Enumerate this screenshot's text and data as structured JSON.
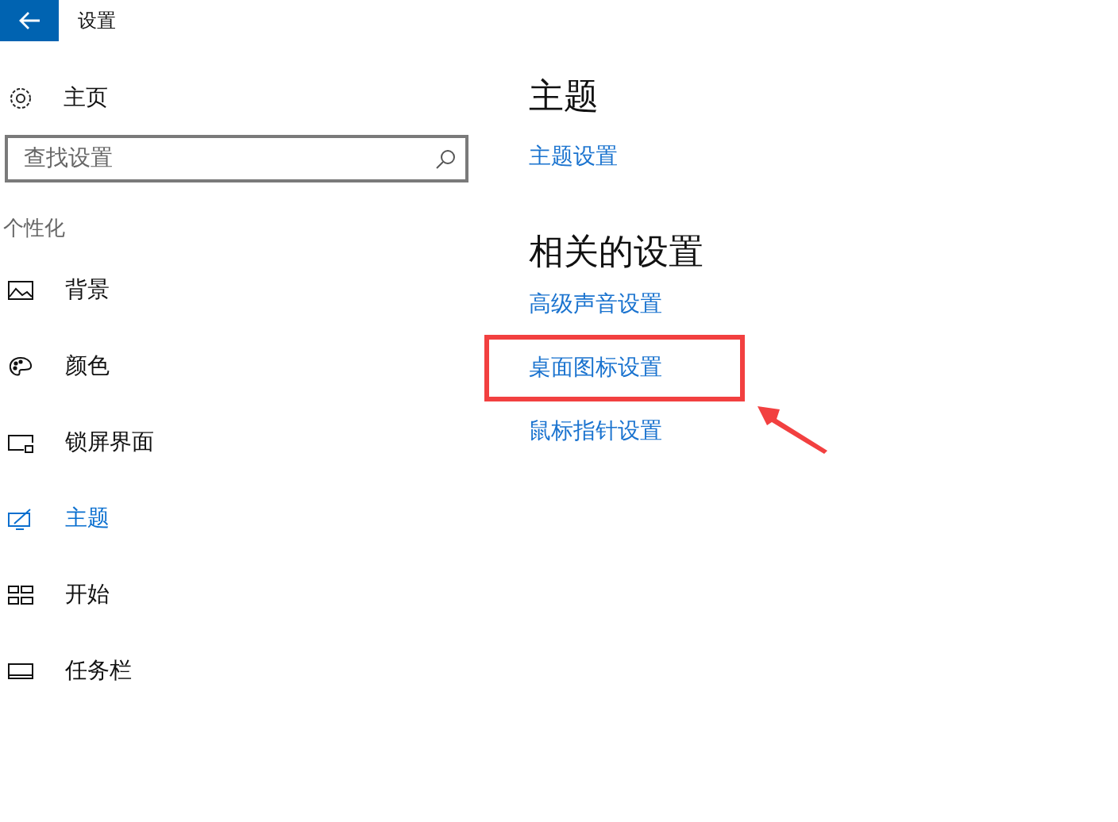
{
  "window": {
    "title": "设置"
  },
  "sidebar": {
    "home": "主页",
    "search": {
      "placeholder": "查找设置"
    },
    "section": "个性化",
    "items": [
      {
        "label": "背景",
        "selected": false
      },
      {
        "label": "颜色",
        "selected": false
      },
      {
        "label": "锁屏界面",
        "selected": false
      },
      {
        "label": "主题",
        "selected": true
      },
      {
        "label": "开始",
        "selected": false
      },
      {
        "label": "任务栏",
        "selected": false
      }
    ]
  },
  "content": {
    "heading": "主题",
    "theme_link": "主题设置",
    "related_heading": "相关的设置",
    "related_links": [
      {
        "label": "高级声音设置",
        "highlighted": false
      },
      {
        "label": "桌面图标设置",
        "highlighted": true
      },
      {
        "label": "鼠标指针设置",
        "highlighted": false
      }
    ]
  }
}
